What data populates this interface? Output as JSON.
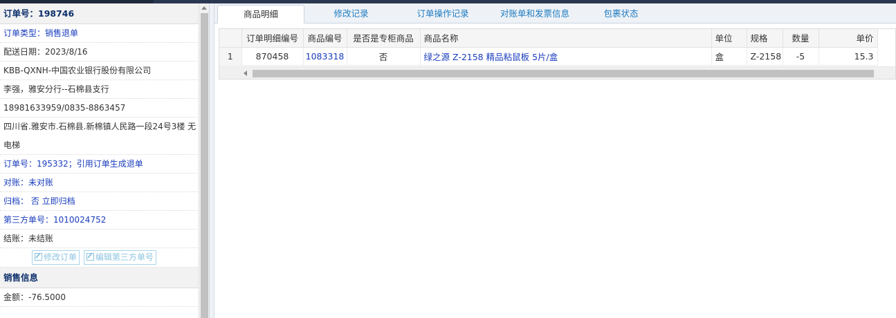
{
  "order": {
    "header": "订单号：198746",
    "type": "订单类型：销售退单",
    "delivery_date": "配送日期：2023/8/16",
    "customer": "KBB-QXNH-中国农业银行股份有限公司",
    "contact": "李强，雅安分行--石棉县支行",
    "phone": "18981633959/0835-8863457",
    "address": "四川省.雅安市.石棉县.新棉镇人民路一段24号3楼 无电梯",
    "ref_order": "订单号：195332；引用订单生成退单",
    "reconcile": "对账：未对账",
    "archive": "归档： 否 立即归档",
    "third_party_no": "第三方单号：1010024752",
    "settlement": "结账：未结账",
    "edit_order_label": "修改订单",
    "edit_third_label": "编辑第三方单号"
  },
  "sales": {
    "header": "销售信息",
    "amount": "金额：-76.5000"
  },
  "tabs": [
    "商品明细",
    "修改记录",
    "订单操作记录",
    "对账单和发票信息",
    "包裹状态"
  ],
  "active_tab": 0,
  "grid": {
    "columns": [
      "订单明细编号",
      "商品编号",
      "是否是专柜商品",
      "商品名称",
      "单位",
      "规格",
      "数量",
      "单价"
    ],
    "rows": [
      [
        "1",
        "870458",
        "1083318",
        "否",
        "绿之源 Z-2158 精品粘鼠板 5片/盒",
        "盒",
        "Z-2158",
        "-5",
        "15.3"
      ]
    ]
  },
  "colors": {
    "link": "#1a3dbd",
    "tab_text": "#1f7bbf",
    "header_text": "#0d2f6b"
  }
}
